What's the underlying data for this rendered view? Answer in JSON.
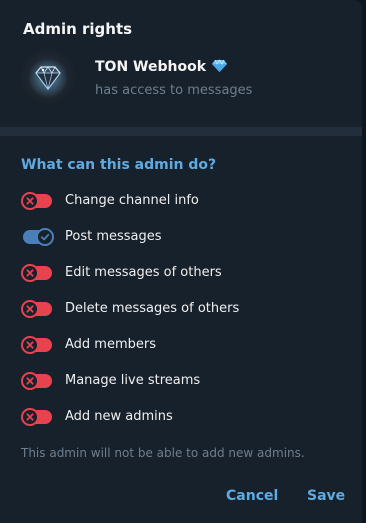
{
  "dialog": {
    "title": "Admin rights"
  },
  "bot": {
    "name": "TON Webhook",
    "status": "has access to messages",
    "avatar_icon": "diamond-icon",
    "badge_icon": "premium-diamond-icon"
  },
  "section": {
    "title": "What can this admin do?"
  },
  "permissions": [
    {
      "label": "Change channel info",
      "enabled": false
    },
    {
      "label": "Post messages",
      "enabled": true
    },
    {
      "label": "Edit messages of others",
      "enabled": false
    },
    {
      "label": "Delete messages of others",
      "enabled": false
    },
    {
      "label": "Add members",
      "enabled": false
    },
    {
      "label": "Manage live streams",
      "enabled": false
    },
    {
      "label": "Add new admins",
      "enabled": false
    }
  ],
  "footnote": "This admin will not be able to add new admins.",
  "buttons": {
    "cancel": "Cancel",
    "save": "Save"
  },
  "colors": {
    "background": "#17212b",
    "accent": "#5eabe3",
    "toggle_off": "#e8424f",
    "toggle_on": "#4a80b8",
    "muted_text": "#6d7f8f"
  }
}
